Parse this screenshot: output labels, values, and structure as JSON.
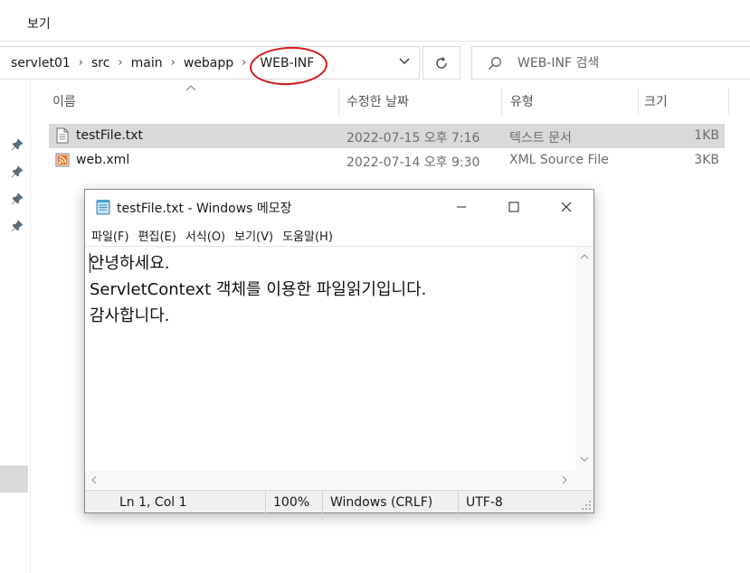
{
  "ribbon": {
    "tab_view": "보기"
  },
  "address": {
    "crumbs": [
      "servlet01",
      "src",
      "main",
      "webapp",
      "WEB-INF"
    ]
  },
  "search": {
    "placeholder": "WEB-INF 검색"
  },
  "columns": {
    "name": "이름",
    "date": "수정한 날짜",
    "type": "유형",
    "size": "크기"
  },
  "files": [
    {
      "name": "testFile.txt",
      "date": "2022-07-15 오후 7:16",
      "type": "텍스트 문서",
      "size": "1KB",
      "icon": "text-file-icon",
      "selected": true
    },
    {
      "name": "web.xml",
      "date": "2022-07-14 오후 9:30",
      "type": "XML Source File",
      "size": "3KB",
      "icon": "xml-file-icon",
      "selected": false
    }
  ],
  "notepad": {
    "title": "testFile.txt - Windows 메모장",
    "menu": [
      "파일(F)",
      "편집(E)",
      "서식(O)",
      "보기(V)",
      "도움말(H)"
    ],
    "lines": [
      "안녕하세요.",
      "ServletContext 객체를 이용한 파일읽기입니다.",
      "감사합니다."
    ],
    "status": {
      "position": "Ln 1, Col 1",
      "zoom": "100%",
      "line_ending": "Windows (CRLF)",
      "encoding": "UTF-8"
    }
  },
  "colors": {
    "annotation": "#d4161c",
    "selected_row": "#d9d9d9",
    "statusbar": "#f0f0f0"
  }
}
